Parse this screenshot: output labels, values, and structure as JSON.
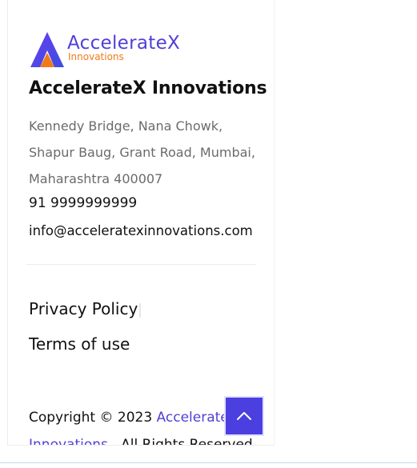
{
  "brand": {
    "logo_word": "AccelerateX",
    "logo_sub": "Innovations",
    "primary_color": "#4f3fd8",
    "accent_color": "#f07a1a"
  },
  "footer": {
    "company_name": "AccelerateX Innovations",
    "address_lines": [
      "Kennedy Bridge, Nana Chowk,",
      "Shapur Baug, Grant Road, Mumbai,",
      "Maharashtra 400007"
    ],
    "phone": "91 9999999999",
    "email": "info@acceleratexinnovations.com",
    "links": {
      "privacy": "Privacy Policy",
      "terms": "Terms of use"
    },
    "copyright": {
      "prefix": "Copyright © 2023 ",
      "company_part1": "AccelerateX",
      "company_part2": "Innovations",
      "suffix": " . All Rights Reserved."
    }
  },
  "scroll_top": {
    "icon": "chevron-up-icon"
  }
}
